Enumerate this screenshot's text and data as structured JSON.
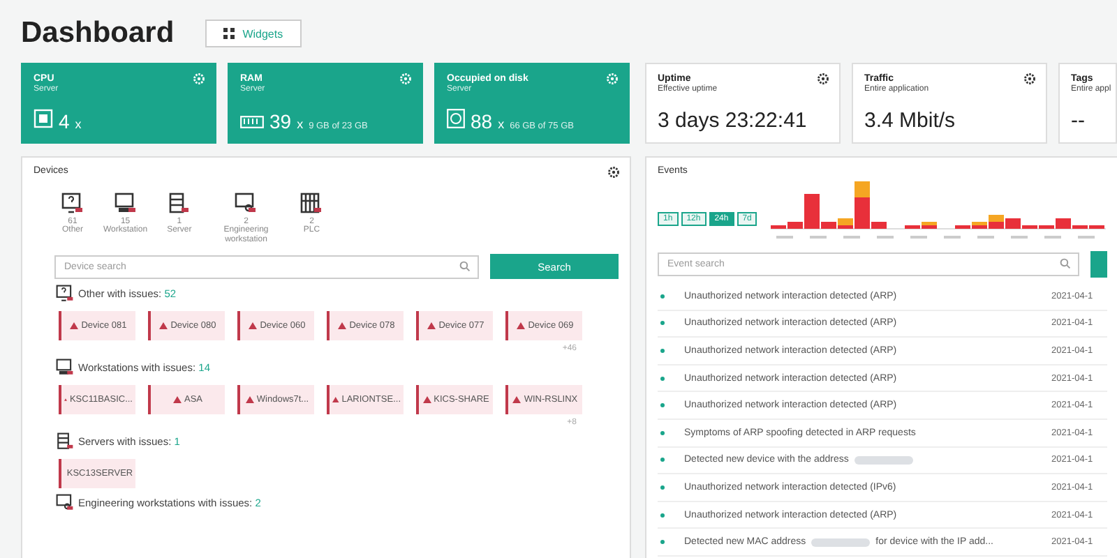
{
  "header": {
    "title": "Dashboard",
    "widgets_button": "Widgets"
  },
  "metrics": [
    {
      "kind": "cpu",
      "title": "CPU",
      "subtitle": "Server",
      "value": "4",
      "unit": "x"
    },
    {
      "kind": "ram",
      "title": "RAM",
      "subtitle": "Server",
      "value": "39",
      "unit": "x",
      "detail": "9 GB of 23 GB"
    },
    {
      "kind": "disk",
      "title": "Occupied on disk",
      "subtitle": "Server",
      "value": "88",
      "unit": "x",
      "detail": "66 GB of 75 GB"
    },
    {
      "kind": "plain",
      "title": "Uptime",
      "subtitle": "Effective uptime",
      "value": "3 days 23:22:41"
    },
    {
      "kind": "plain",
      "title": "Traffic",
      "subtitle": "Entire application",
      "value": "3.4 Mbit/s"
    },
    {
      "kind": "clipped",
      "title": "Tags",
      "subtitle": "Entire appl",
      "value": "--"
    }
  ],
  "devices": {
    "title": "Devices",
    "types": [
      {
        "kind": "other",
        "count": "61",
        "label": "Other"
      },
      {
        "kind": "workstation",
        "count": "15",
        "label": "Workstation"
      },
      {
        "kind": "server",
        "count": "1",
        "label": "Server"
      },
      {
        "kind": "engineering",
        "count": "2",
        "label": "Engineering workstation"
      },
      {
        "kind": "plc",
        "count": "2",
        "label": "PLC"
      }
    ],
    "search": {
      "placeholder": "Device search",
      "button": "Search"
    },
    "groups": [
      {
        "kind": "other",
        "label": "Other with issues:",
        "count": "52",
        "items": [
          "Device 081",
          "Device 080",
          "Device 060",
          "Device 078",
          "Device 077",
          "Device 069"
        ],
        "more": "+46"
      },
      {
        "kind": "workstation",
        "label": "Workstations with issues:",
        "count": "14",
        "items": [
          "KSC11BASIC...",
          "ASA",
          "Windows7t...",
          "LARIONTSE...",
          "KICS-SHARE",
          "WIN-RSLINX"
        ],
        "more": "+8"
      },
      {
        "kind": "server",
        "label": "Servers with issues:",
        "count": "1",
        "items": [
          "KSC13SERVER"
        ]
      },
      {
        "kind": "engineering",
        "label": "Engineering workstations with issues:",
        "count": "2"
      }
    ]
  },
  "events": {
    "title": "Events",
    "ranges": [
      {
        "label": "1h",
        "selected": false
      },
      {
        "label": "12h",
        "selected": false
      },
      {
        "label": "24h",
        "selected": true
      },
      {
        "label": "7d",
        "selected": false
      }
    ],
    "search": {
      "placeholder": "Event search"
    },
    "rows": [
      {
        "kind": "plain",
        "text": "Unauthorized network interaction detected (ARP)",
        "date": "2021-04-1"
      },
      {
        "kind": "plain",
        "text": "Unauthorized network interaction detected (ARP)",
        "date": "2021-04-1"
      },
      {
        "kind": "plain",
        "text": "Unauthorized network interaction detected (ARP)",
        "date": "2021-04-1"
      },
      {
        "kind": "plain",
        "text": "Unauthorized network interaction detected (ARP)",
        "date": "2021-04-1"
      },
      {
        "kind": "plain",
        "text": "Unauthorized network interaction detected (ARP)",
        "date": "2021-04-1"
      },
      {
        "kind": "plain",
        "text": "Symptoms of ARP spoofing detected in ARP requests",
        "date": "2021-04-1"
      },
      {
        "kind": "redacted",
        "text": "Detected new device with the address",
        "date": "2021-04-1"
      },
      {
        "kind": "plain",
        "text": "Unauthorized network interaction detected (IPv6)",
        "date": "2021-04-1"
      },
      {
        "kind": "plain",
        "text": "Unauthorized network interaction detected (ARP)",
        "date": "2021-04-1"
      },
      {
        "kind": "redacted",
        "text": "Detected new MAC address",
        "after": "for device with the IP add...",
        "date": "2021-04-1"
      }
    ]
  }
}
